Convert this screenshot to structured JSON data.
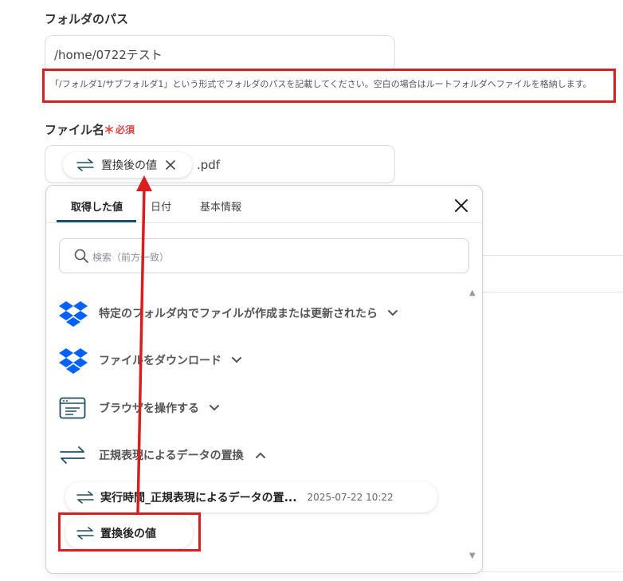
{
  "folder": {
    "label": "フォルダのパス",
    "value": "/home/0722テスト",
    "hint": "「/フォルダ1/サブフォルダ1」という形式でフォルダのパスを記載してください。空白の場合はルートフォルダへファイルを格納します。"
  },
  "filename": {
    "label": "ファイル名",
    "required_mark": "＊",
    "required_text": "必須",
    "chip_label": "置換後の値",
    "suffix": ".pdf"
  },
  "popup": {
    "tabs": [
      {
        "label": "取得した値",
        "active": true
      },
      {
        "label": "日付",
        "active": false
      },
      {
        "label": "基本情報",
        "active": false
      }
    ],
    "search_placeholder": "検索（前方一致）",
    "sections": [
      {
        "label": "特定のフォルダ内でファイルが作成または更新されたら",
        "icon": "dropbox-icon",
        "expanded": false
      },
      {
        "label": "ファイルをダウンロード",
        "icon": "dropbox-icon",
        "expanded": false
      },
      {
        "label": "ブラウザを操作する",
        "icon": "browser-icon",
        "expanded": false
      },
      {
        "label": "正規表現によるデータの置換",
        "icon": "swap-arrows-icon",
        "expanded": true
      }
    ],
    "values": [
      {
        "name": "実行時間_正規表現によるデータの置...",
        "date": "2025-07-22 10:22"
      },
      {
        "name": "置換後の値",
        "date": ""
      }
    ]
  },
  "colors": {
    "highlight_red": "#d81e1e",
    "accent_teal": "#1c4f66",
    "dropbox_blue": "#0061fe",
    "required_red": "#e04040"
  }
}
